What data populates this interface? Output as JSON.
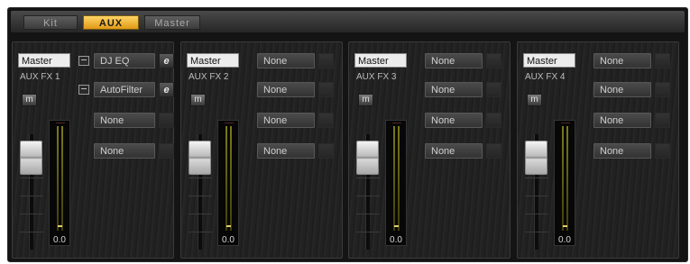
{
  "tabs": [
    {
      "label": "Kit",
      "active": false
    },
    {
      "label": "AUX",
      "active": true
    },
    {
      "label": "Master",
      "active": false
    }
  ],
  "accent_color": "#f5b830",
  "aux_channels": [
    {
      "output": "Master",
      "name": "AUX FX 1",
      "mute_label": "m",
      "level": "0.0",
      "fx_slots": [
        {
          "name": "DJ EQ",
          "edit_label": "e",
          "loaded": true
        },
        {
          "name": "AutoFilter",
          "edit_label": "e",
          "loaded": true
        },
        {
          "name": "None",
          "edit_label": "",
          "loaded": false
        },
        {
          "name": "None",
          "edit_label": "",
          "loaded": false
        }
      ]
    },
    {
      "output": "Master",
      "name": "AUX FX 2",
      "mute_label": "m",
      "level": "0.0",
      "fx_slots": [
        {
          "name": "None",
          "edit_label": "",
          "loaded": false
        },
        {
          "name": "None",
          "edit_label": "",
          "loaded": false
        },
        {
          "name": "None",
          "edit_label": "",
          "loaded": false
        },
        {
          "name": "None",
          "edit_label": "",
          "loaded": false
        }
      ]
    },
    {
      "output": "Master",
      "name": "AUX FX 3",
      "mute_label": "m",
      "level": "0.0",
      "fx_slots": [
        {
          "name": "None",
          "edit_label": "",
          "loaded": false
        },
        {
          "name": "None",
          "edit_label": "",
          "loaded": false
        },
        {
          "name": "None",
          "edit_label": "",
          "loaded": false
        },
        {
          "name": "None",
          "edit_label": "",
          "loaded": false
        }
      ]
    },
    {
      "output": "Master",
      "name": "AUX FX 4",
      "mute_label": "m",
      "level": "0.0",
      "fx_slots": [
        {
          "name": "None",
          "edit_label": "",
          "loaded": false
        },
        {
          "name": "None",
          "edit_label": "",
          "loaded": false
        },
        {
          "name": "None",
          "edit_label": "",
          "loaded": false
        },
        {
          "name": "None",
          "edit_label": "",
          "loaded": false
        }
      ]
    }
  ]
}
